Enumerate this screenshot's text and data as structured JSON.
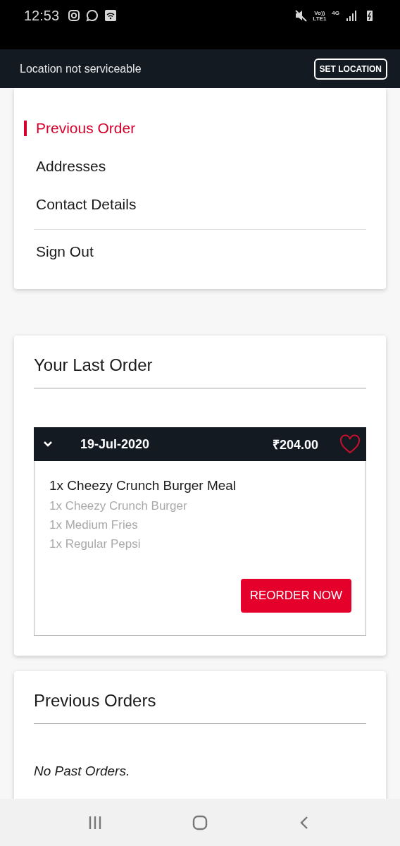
{
  "status_bar": {
    "time": "12:53",
    "network_labels": [
      "Vo))\nLTE1",
      "4G"
    ]
  },
  "location_bar": {
    "message": "Location not serviceable",
    "button": "SET LOCATION"
  },
  "account_menu": {
    "items": [
      {
        "label": "Previous Order",
        "selected": true
      },
      {
        "label": "Addresses",
        "selected": false
      },
      {
        "label": "Contact Details",
        "selected": false
      }
    ],
    "footer_items": [
      {
        "label": "Sign Out",
        "selected": false
      }
    ]
  },
  "last_order": {
    "title": "Your Last Order",
    "order": {
      "expanded": true,
      "date": "19-Jul-2020",
      "total": "₹204.00",
      "favorite": false,
      "main_item": "1x Cheezy Crunch Burger Meal",
      "sub_items": [
        "1x Cheezy Crunch Burger",
        "1x Medium Fries",
        "1x Regular Pepsi"
      ],
      "button": "REORDER NOW"
    }
  },
  "previous_orders": {
    "title": "Previous Orders",
    "empty_message": "No Past Orders."
  }
}
